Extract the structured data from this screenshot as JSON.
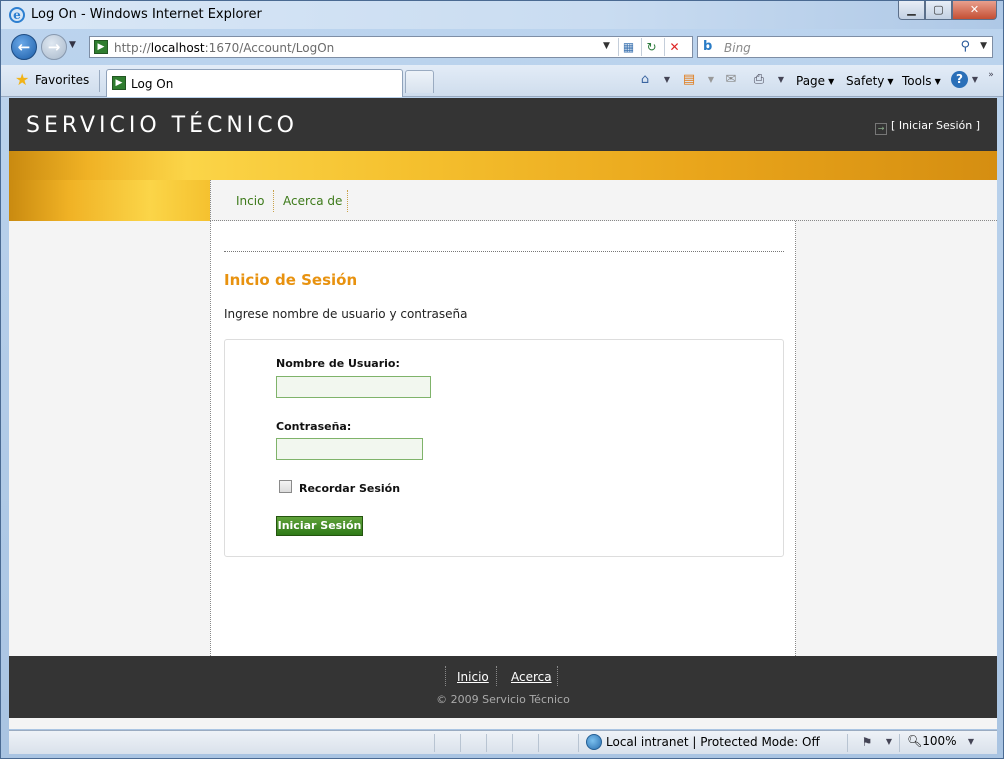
{
  "window": {
    "title": "Log On - Windows Internet Explorer",
    "minimize": "▁",
    "maximize": "▢",
    "close": "✕"
  },
  "address_bar": {
    "url_prefix": "http://",
    "url_host": "localhost",
    "url_rest": ":1670/Account/LogOn"
  },
  "search": {
    "placeholder": "Bing"
  },
  "toolbar": {
    "favorites_label": "Favorites",
    "tab_label": "Log On",
    "page_label": "Page",
    "safety_label": "Safety",
    "tools_label": "Tools"
  },
  "site": {
    "title": "SERVICIO TÉCNICO",
    "login_link": "[ Iniciar Sesión ]",
    "menu": [
      "Incio",
      "Acerca de"
    ]
  },
  "login": {
    "heading": "Inicio de Sesión",
    "intro": "Ingrese nombre de usuario y contraseña",
    "username_label": "Nombre de Usuario:",
    "username_value": "",
    "password_label": "Contraseña:",
    "password_value": "",
    "remember_label": "Recordar Sesión",
    "remember_checked": false,
    "submit_label": "Iniciar Sesión"
  },
  "footer": {
    "links": [
      "Inicio",
      "Acerca"
    ],
    "copyright": "© 2009 Servicio Técnico"
  },
  "status": {
    "zone": "Local intranet | Protected Mode: Off",
    "zoom": "100%"
  },
  "colors": {
    "header_bg": "#343434",
    "accent_orange": "#e8920f",
    "link_green": "#3d7a1a",
    "button_green": "#2f7a17"
  }
}
